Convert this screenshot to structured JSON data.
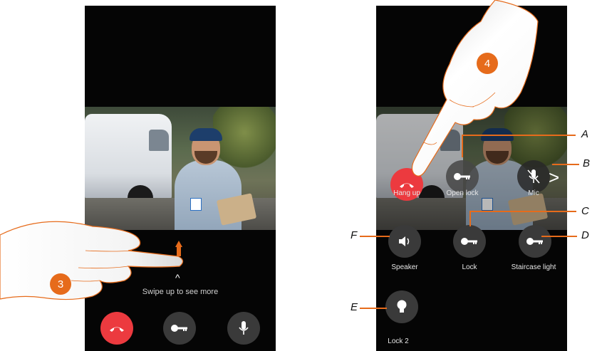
{
  "left_screen": {
    "hint": "Swipe up to see more",
    "chevron": "^",
    "buttons": [
      {
        "name": "hang-up",
        "icon": "phone-hangup-icon"
      },
      {
        "name": "open-lock",
        "icon": "key-icon"
      },
      {
        "name": "mic",
        "icon": "microphone-icon"
      }
    ],
    "step": "3"
  },
  "right_screen": {
    "overlay_labels": {
      "hang_up": "Hang up",
      "open_lock": "Open lock",
      "mic": "Mic"
    },
    "controls": {
      "speaker": "Speaker",
      "lock": "Lock",
      "staircase": "Staircase light",
      "lock2": "Lock 2"
    },
    "step": "4",
    "next_arrow": ">"
  },
  "callouts": {
    "a": "A",
    "b": "B",
    "c": "C",
    "d": "D",
    "e": "E",
    "f": "F"
  },
  "colors": {
    "accent": "#e66b1b",
    "hangup": "#ec3a3f",
    "button_dark": "#3a3a3a"
  }
}
